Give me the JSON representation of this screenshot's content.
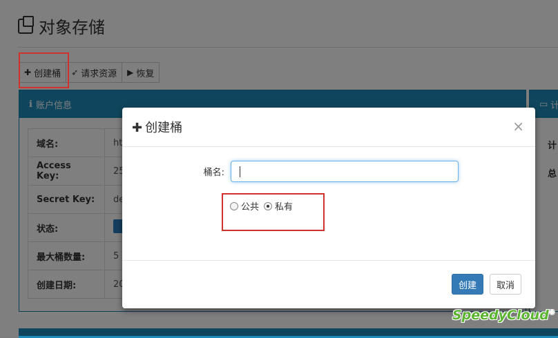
{
  "page": {
    "title": "对象存储"
  },
  "toolbar": {
    "create_label": "创建桶",
    "request_label": "请求资源",
    "restore_label": "恢复"
  },
  "account_panel": {
    "title": "账户信息",
    "rows": [
      {
        "label": "域名:",
        "value": "ht"
      },
      {
        "label": "Access Key:",
        "value": "25"
      },
      {
        "label": "Secret Key:",
        "value": "de"
      },
      {
        "label": "状态:",
        "value": ""
      },
      {
        "label": "最大桶数量:",
        "value": "5"
      },
      {
        "label": "创建日期:",
        "value": "20"
      }
    ]
  },
  "right_panel": {
    "title": "计",
    "rows": [
      "计",
      "总"
    ]
  },
  "modal": {
    "title": "创建桶",
    "bucket_name_label": "桶名:",
    "bucket_name_value": "",
    "radio_public": "公共",
    "radio_private": "私有",
    "confirm_label": "创建",
    "cancel_label": "取消"
  },
  "watermark": {
    "text": "SpeedyCloud"
  },
  "colors": {
    "accent": "#1f8dbb",
    "highlight": "#d0312d",
    "primary": "#337ab7",
    "brand_green": "#5cb531"
  }
}
